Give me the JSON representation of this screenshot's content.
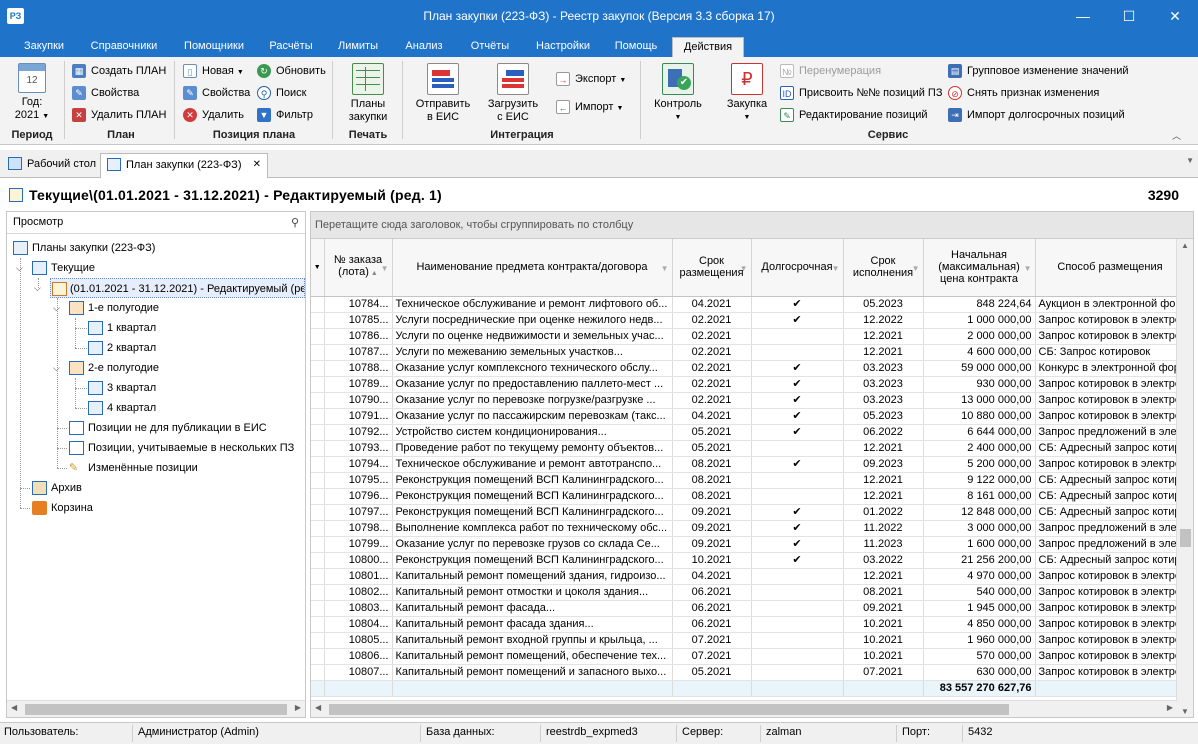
{
  "window": {
    "title": "План закупки (223-ФЗ) - Реестр закупок (Версия 3.3 сборка 17)",
    "app_icon_text": "РЗ",
    "minimize": "—",
    "maximize": "☐",
    "close": "✕"
  },
  "menu": {
    "tabs": [
      "Закупки",
      "Справочники",
      "Помощники",
      "Расчёты",
      "Лимиты",
      "Анализ",
      "Отчёты",
      "Настройки",
      "Помощь",
      "Действия"
    ],
    "active": "Действия"
  },
  "ribbon": {
    "period": {
      "label": "Год:",
      "value": "2021",
      "calendar_day": "12",
      "group": "Период"
    },
    "plan": {
      "create": "Создать ПЛАН",
      "props": "Свойства",
      "delete": "Удалить ПЛАН",
      "group": "План"
    },
    "position": {
      "new": "Новая",
      "props": "Свойства",
      "delete": "Удалить",
      "refresh": "Обновить",
      "search": "Поиск",
      "filter": "Фильтр",
      "group": "Позиция плана"
    },
    "print": {
      "plans": "Планы",
      "purchases": "закупки",
      "group": "Печать"
    },
    "integration": {
      "send1": "Отправить",
      "send2": "в ЕИС",
      "load1": "Загрузить",
      "load2": "с ЕИС",
      "export": "Экспорт",
      "import": "Импорт",
      "group": "Интеграция"
    },
    "service": {
      "control": "Контроль",
      "purchase": "Закупка",
      "renumber": "Перенумерация",
      "assign": "Присвоить №№ позиций ПЗ",
      "edit_positions": "Редактирование позиций",
      "group_change": "Групповое изменение значений",
      "remove_flag": "Снять признак изменения",
      "import_long": "Импорт долгосрочных позиций",
      "group": "Сервис"
    }
  },
  "doc_tabs": {
    "desktop": "Рабочий стол",
    "plan": "План закупки (223-ФЗ)",
    "close": "✕"
  },
  "header": {
    "path": "Текущие\\(01.01.2021 - 31.12.2021) - Редактируемый (ред. 1)",
    "count": "3290"
  },
  "tree": {
    "title": "Просмотр",
    "nodes": {
      "root": "Планы закупки (223-ФЗ)",
      "current": "Текущие",
      "plan": "(01.01.2021 - 31.12.2021) - Редактируемый (ред. 1)",
      "h1": "1-е полугодие",
      "q1": "1 квартал",
      "q2": "2 квартал",
      "h2": "2-е полугодие",
      "q3": "3 квартал",
      "q4": "4 квартал",
      "not_published": "Позиции не для публикации в ЕИС",
      "multi": "Позиции, учитываемые в нескольких ПЗ",
      "changed": "Изменённые позиции",
      "archive": "Архив",
      "trash": "Корзина"
    }
  },
  "grid": {
    "group_hint": "Перетащите сюда заголовок, чтобы сгруппировать по столбцу",
    "columns": {
      "lot_num": "№ заказа (лота)",
      "name": "Наименование предмета контракта/договора",
      "placement_term": "Срок размещения",
      "long_term": "Долгосрочная",
      "exec_term": "Срок исполнения",
      "price": "Начальная (максимальная) цена контракта",
      "method": "Способ размещения"
    },
    "check_mark": "✔",
    "rows": [
      {
        "n": "10784...",
        "name": "Техническое обслуживание и ремонт лифтового об...",
        "pt": "04.2021",
        "lt": "✔",
        "et": "05.2023",
        "price": "848 224,64",
        "method": "Аукцион в электронной фор"
      },
      {
        "n": "10785...",
        "name": "Услуги посреднические при оценке нежилого недв...",
        "pt": "02.2021",
        "lt": "✔",
        "et": "12.2022",
        "price": "1 000 000,00",
        "method": "Запрос котировок в электро"
      },
      {
        "n": "10786...",
        "name": "Услуги по оценке недвижимости и земельных учас...",
        "pt": "02.2021",
        "lt": "",
        "et": "12.2021",
        "price": "2 000 000,00",
        "method": "Запрос котировок в электро"
      },
      {
        "n": "10787...",
        "name": "Услуги по межеванию земельных участков...",
        "pt": "02.2021",
        "lt": "",
        "et": "12.2021",
        "price": "4 600 000,00",
        "method": "СБ: Запрос котировок"
      },
      {
        "n": "10788...",
        "name": "Оказание услуг комплексного технического обслу...",
        "pt": "02.2021",
        "lt": "✔",
        "et": "03.2023",
        "price": "59 000 000,00",
        "method": "Конкурс в электронной фор"
      },
      {
        "n": "10789...",
        "name": "Оказание услуг по предоставлению паллето-мест ...",
        "pt": "02.2021",
        "lt": "✔",
        "et": "03.2023",
        "price": "930 000,00",
        "method": "Запрос котировок в электро"
      },
      {
        "n": "10790...",
        "name": "Оказание услуг по перевозке погрузке/разгрузке ...",
        "pt": "02.2021",
        "lt": "✔",
        "et": "03.2023",
        "price": "13 000 000,00",
        "method": "Запрос котировок в электро"
      },
      {
        "n": "10791...",
        "name": "Оказание услуг по пассажирским перевозкам (такс...",
        "pt": "04.2021",
        "lt": "✔",
        "et": "05.2023",
        "price": "10 880 000,00",
        "method": "Запрос котировок в электро"
      },
      {
        "n": "10792...",
        "name": "Устройство систем кондиционирования...",
        "pt": "05.2021",
        "lt": "✔",
        "et": "06.2022",
        "price": "6 644 000,00",
        "method": "Запрос предложений в элек"
      },
      {
        "n": "10793...",
        "name": "Проведение работ по текущему ремонту объектов...",
        "pt": "05.2021",
        "lt": "",
        "et": "12.2021",
        "price": "2 400 000,00",
        "method": "СБ: Адресный запрос котир"
      },
      {
        "n": "10794...",
        "name": "Техническое обслуживание и ремонт автотранспо...",
        "pt": "08.2021",
        "lt": "✔",
        "et": "09.2023",
        "price": "5 200 000,00",
        "method": "Запрос котировок в электро"
      },
      {
        "n": "10795...",
        "name": "Реконструкция помещений ВСП Калининградского...",
        "pt": "08.2021",
        "lt": "",
        "et": "12.2021",
        "price": "9 122 000,00",
        "method": "СБ: Адресный запрос котир"
      },
      {
        "n": "10796...",
        "name": "Реконструкция помещений ВСП Калининградского...",
        "pt": "08.2021",
        "lt": "",
        "et": "12.2021",
        "price": "8 161 000,00",
        "method": "СБ: Адресный запрос котир"
      },
      {
        "n": "10797...",
        "name": "Реконструкция помещений ВСП Калининградского...",
        "pt": "09.2021",
        "lt": "✔",
        "et": "01.2022",
        "price": "12 848 000,00",
        "method": "СБ: Адресный запрос котир"
      },
      {
        "n": "10798...",
        "name": "Выполнение комплекса работ по техническому обс...",
        "pt": "09.2021",
        "lt": "✔",
        "et": "11.2022",
        "price": "3 000 000,00",
        "method": "Запрос предложений в элек"
      },
      {
        "n": "10799...",
        "name": "Оказание услуг по перевозке грузов со склада Се...",
        "pt": "09.2021",
        "lt": "✔",
        "et": "11.2023",
        "price": "1 600 000,00",
        "method": "Запрос предложений в элек"
      },
      {
        "n": "10800...",
        "name": "Реконструкция помещений ВСП Калининградского...",
        "pt": "10.2021",
        "lt": "✔",
        "et": "03.2022",
        "price": "21 256 200,00",
        "method": "СБ: Адресный запрос котир"
      },
      {
        "n": "10801...",
        "name": "Капитальный ремонт помещений здания, гидроизо...",
        "pt": "04.2021",
        "lt": "",
        "et": "12.2021",
        "price": "4 970 000,00",
        "method": "Запрос котировок в электро"
      },
      {
        "n": "10802...",
        "name": "Капитальный ремонт отмостки и цоколя здания...",
        "pt": "06.2021",
        "lt": "",
        "et": "08.2021",
        "price": "540 000,00",
        "method": "Запрос котировок в электро"
      },
      {
        "n": "10803...",
        "name": "Капитальный ремонт фасада...",
        "pt": "06.2021",
        "lt": "",
        "et": "09.2021",
        "price": "1 945 000,00",
        "method": "Запрос котировок в электро"
      },
      {
        "n": "10804...",
        "name": "Капитальный ремонт фасада здания...",
        "pt": "06.2021",
        "lt": "",
        "et": "10.2021",
        "price": "4 850 000,00",
        "method": "Запрос котировок в электро"
      },
      {
        "n": "10805...",
        "name": "Капитальный ремонт входной группы и крыльца, ...",
        "pt": "07.2021",
        "lt": "",
        "et": "10.2021",
        "price": "1 960 000,00",
        "method": "Запрос котировок в электро"
      },
      {
        "n": "10806...",
        "name": "Капитальный ремонт помещений, обеспечение тех...",
        "pt": "07.2021",
        "lt": "",
        "et": "10.2021",
        "price": "570 000,00",
        "method": "Запрос котировок в электро"
      },
      {
        "n": "10807...",
        "name": "Капитальный ремонт помещений и запасного выхо...",
        "pt": "05.2021",
        "lt": "",
        "et": "07.2021",
        "price": "630 000,00",
        "method": "Запрос котировок в электро"
      }
    ],
    "total": "83 557 270 627,76"
  },
  "status": {
    "user_label": "Пользователь:",
    "user": "Администратор (Admin)",
    "db_label": "База данных:",
    "db": "reestrdb_expmed3",
    "server_label": "Сервер:",
    "server": "zalman",
    "port_label": "Порт:",
    "port": "5432"
  }
}
